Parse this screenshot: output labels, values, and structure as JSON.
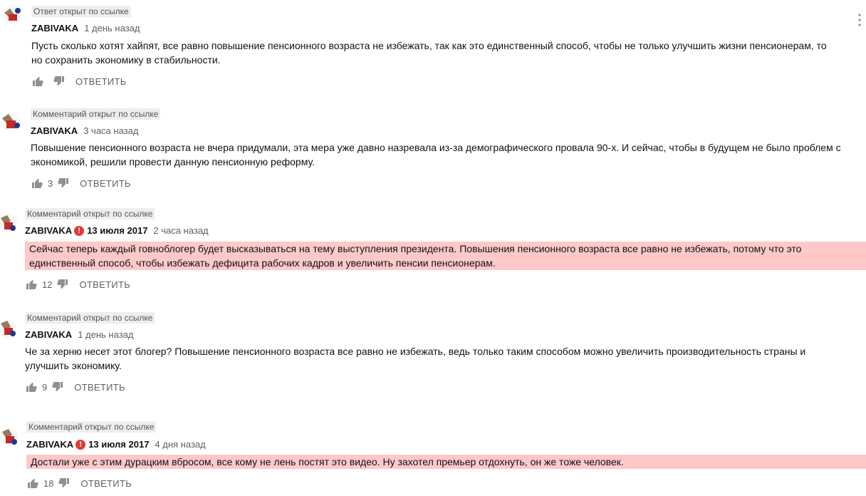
{
  "colors": {
    "highlight": "#ffc9c9",
    "mark": "#e53935",
    "badge_bg": "#eeeeee"
  },
  "icons": {
    "like": "thumbs-up-icon",
    "dislike": "thumbs-down-icon",
    "menu": "more-vert-icon",
    "mark": "exclamation-icon"
  },
  "comments": [
    {
      "badge": "Ответ открыт по ссылке",
      "author": "ZABIVAKA",
      "time": "1 день назад",
      "lines": [
        "Пусть сколько хотят хайпят, все равно повышение пенсионного возраста не избежать, так как это единственный способ, чтобы не только улучшить жизни пенсионерам, то",
        "но сохранить экономику в стабильности."
      ],
      "likes": "",
      "reply": "ОТВЕТИТЬ"
    },
    {
      "badge": "Комментарий открыт по ссылке",
      "author": "ZABIVAKA",
      "time": "3 часа назад",
      "lines": [
        "Повышение пенсионного возраста не вчера придумали, эта мера уже давно назревала из-за демографического провала 90-х. И сейчас, чтобы в будущем не было проблем с",
        "экономикой, решили провести данную пенсионную реформу."
      ],
      "likes": "3",
      "reply": "ОТВЕТИТЬ"
    },
    {
      "badge": "Комментарий открыт по ссылке",
      "author": "ZABIVAKA",
      "mark": "!",
      "date": "13 июля 2017",
      "time": "2 часа назад",
      "lines": [
        "Сейчас теперь каждый говноблогер будет высказываться на тему выступления президента. Повышения пенсионного возраста все равно не избежать, потому что это",
        "единственный способ, чтобы избежать дефицита рабочих кадров и увеличить пенсии пенсионерам."
      ],
      "likes": "12",
      "reply": "ОТВЕТИТЬ"
    },
    {
      "badge": "Комментарий открыт по ссылке",
      "author": "ZABIVAKA",
      "time": "1 день назад",
      "lines": [
        "Че за херню несет этот блогер? Повышение пенсионного возраста все равно не избежать, ведь только таким способом можно увеличить производительность страны и",
        "улучшить экономику."
      ],
      "likes": "9",
      "reply": "ОТВЕТИТЬ"
    },
    {
      "badge": "Комментарий открыт по ссылке",
      "author": "ZABIVAKA",
      "mark": "!",
      "date": "13 июля 2017",
      "time": "4 дня назад",
      "lines": [
        "Достали уже с этим дурацким вбросом, все кому не лень постят это видео. Ну захотел премьер отдохнуть, он же тоже человек."
      ],
      "likes": "18",
      "reply": "ОТВЕТИТЬ"
    }
  ]
}
